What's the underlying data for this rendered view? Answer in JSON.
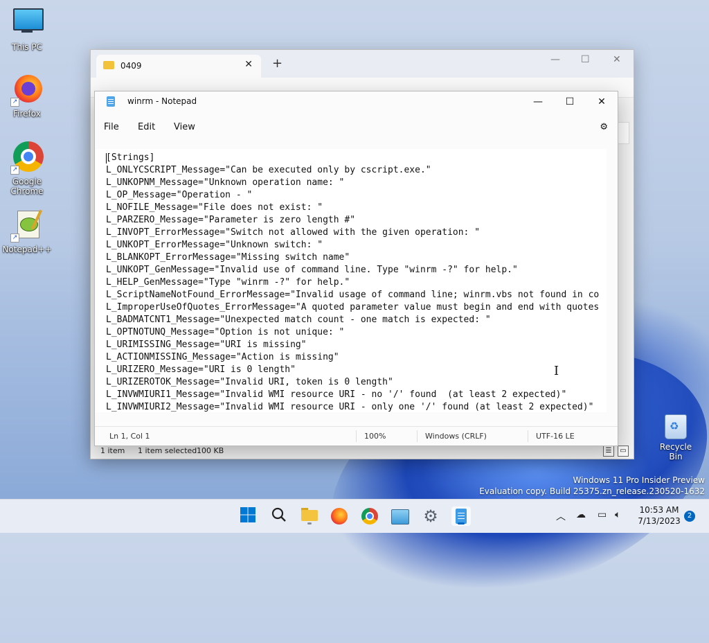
{
  "desktop": {
    "icons": [
      {
        "label": "This PC"
      },
      {
        "label": "Firefox"
      },
      {
        "label": "Google Chrome"
      },
      {
        "label": "Notepad++"
      },
      {
        "label": "Recycle Bin"
      }
    ],
    "watermark": {
      "line1": "Windows 11 Pro Insider Preview",
      "line2": "Evaluation copy. Build 25375.zn_release.230520-1632"
    }
  },
  "explorer": {
    "tab_title": "0409",
    "new_tab_symbol": "+",
    "status": {
      "items": "1 item",
      "selected": "1 item selected",
      "size": "100 KB"
    }
  },
  "notepad": {
    "title": "winrm - Notepad",
    "menu": [
      "File",
      "Edit",
      "View"
    ],
    "lines": [
      "[Strings]",
      "L_ONLYCSCRIPT_Message=\"Can be executed only by cscript.exe.\"",
      "L_UNKOPNM_Message=\"Unknown operation name: \"",
      "L_OP_Message=\"Operation - \"",
      "L_NOFILE_Message=\"File does not exist: \"",
      "L_PARZERO_Message=\"Parameter is zero length #\"",
      "L_INVOPT_ErrorMessage=\"Switch not allowed with the given operation: \"",
      "L_UNKOPT_ErrorMessage=\"Unknown switch: \"",
      "L_BLANKOPT_ErrorMessage=\"Missing switch name\"",
      "L_UNKOPT_GenMessage=\"Invalid use of command line. Type \"winrm -?\" for help.\"",
      "L_HELP_GenMessage=\"Type \"winrm -?\" for help.\"",
      "L_ScriptNameNotFound_ErrorMessage=\"Invalid usage of command line; winrm.vbs not found in co",
      "L_ImproperUseOfQuotes_ErrorMessage=\"A quoted parameter value must begin and end with quotes",
      "L_BADMATCNT1_Message=\"Unexpected match count - one match is expected: \"",
      "L_OPTNOTUNQ_Message=\"Option is not unique: \"",
      "L_URIMISSING_Message=\"URI is missing\"",
      "L_ACTIONMISSING_Message=\"Action is missing\"",
      "L_URIZERO_Message=\"URI is 0 length\"",
      "L_URIZEROTOK_Message=\"Invalid URI, token is 0 length\"",
      "L_INVWMIURI1_Message=\"Invalid WMI resource URI - no '/' found  (at least 2 expected)\"",
      "L_INVWMIURI2_Message=\"Invalid WMI resource URI - only one '/' found (at least 2 expected)\""
    ],
    "status": {
      "position": "Ln 1, Col 1",
      "zoom": "100%",
      "line_ending": "Windows (CRLF)",
      "encoding": "UTF-16 LE"
    }
  },
  "taskbar": {
    "clock_time": "10:53 AM",
    "clock_date": "7/13/2023",
    "notification_count": "2"
  }
}
